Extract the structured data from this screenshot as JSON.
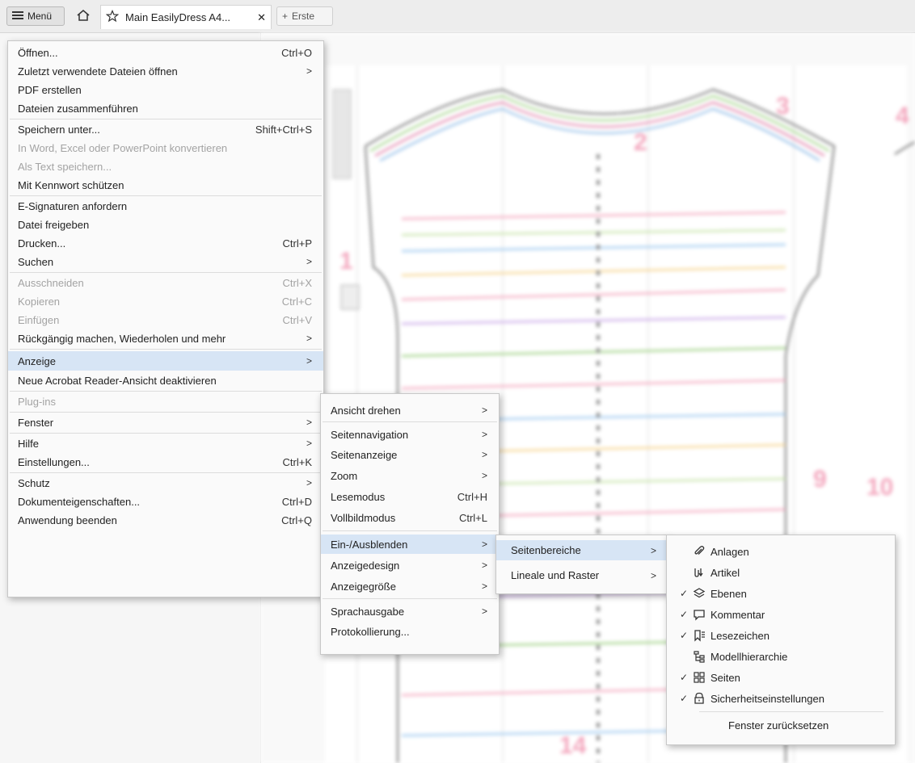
{
  "topbar": {
    "menu_label": "Menü",
    "tab_title": "Main EasilyDress A4...",
    "tab_close": "✕",
    "new_tab_label": "Erste"
  },
  "main_menu": {
    "items": [
      {
        "label": "Öffnen...",
        "shortcut": "Ctrl+O"
      },
      {
        "label": "Zuletzt verwendete Dateien öffnen",
        "arrow": ">"
      },
      {
        "label": "PDF erstellen"
      },
      {
        "label": "Dateien zusammenführen"
      },
      {
        "label": "Speichern unter...",
        "shortcut": "Shift+Ctrl+S"
      },
      {
        "label": "In Word, Excel oder PowerPoint konvertieren",
        "disabled": true
      },
      {
        "label": "Als Text speichern...",
        "disabled": true
      },
      {
        "label": "Mit Kennwort schützen"
      },
      {
        "label": "E-Signaturen anfordern"
      },
      {
        "label": "Datei freigeben"
      },
      {
        "label": "Drucken...",
        "shortcut": "Ctrl+P"
      },
      {
        "label": "Suchen",
        "arrow": ">"
      },
      {
        "label": "Ausschneiden",
        "shortcut": "Ctrl+X",
        "disabled": true
      },
      {
        "label": "Kopieren",
        "shortcut": "Ctrl+C",
        "disabled": true
      },
      {
        "label": "Einfügen",
        "shortcut": "Ctrl+V",
        "disabled": true
      },
      {
        "label": "Rückgängig machen, Wiederholen und mehr",
        "arrow": ">"
      },
      {
        "label": "Anzeige",
        "arrow": ">",
        "highlighted": true
      },
      {
        "label": "Neue Acrobat Reader-Ansicht deaktivieren"
      },
      {
        "label": "Plug-ins",
        "disabled": true
      },
      {
        "label": "Fenster",
        "arrow": ">"
      },
      {
        "label": "Hilfe",
        "arrow": ">"
      },
      {
        "label": "Einstellungen...",
        "shortcut": "Ctrl+K"
      },
      {
        "label": "Schutz",
        "arrow": ">"
      },
      {
        "label": "Dokumenteigenschaften...",
        "shortcut": "Ctrl+D"
      },
      {
        "label": "Anwendung beenden",
        "shortcut": "Ctrl+Q"
      }
    ]
  },
  "view_menu": {
    "items": [
      {
        "label": "Ansicht drehen",
        "arrow": ">"
      },
      {
        "label": "Seitennavigation",
        "arrow": ">"
      },
      {
        "label": "Seitenanzeige",
        "arrow": ">"
      },
      {
        "label": "Zoom",
        "arrow": ">"
      },
      {
        "label": "Lesemodus",
        "shortcut": "Ctrl+H"
      },
      {
        "label": "Vollbildmodus",
        "shortcut": "Ctrl+L"
      },
      {
        "label": "Ein-/Ausblenden",
        "arrow": ">",
        "highlighted": true
      },
      {
        "label": "Anzeigedesign",
        "arrow": ">"
      },
      {
        "label": "Anzeigegröße",
        "arrow": ">"
      },
      {
        "label": "Sprachausgabe",
        "arrow": ">"
      },
      {
        "label": "Protokollierung..."
      }
    ]
  },
  "showhide_menu": {
    "items": [
      {
        "label": "Seitenbereiche",
        "arrow": ">",
        "highlighted": true
      },
      {
        "label": "Lineale und Raster",
        "arrow": ">"
      }
    ]
  },
  "panes_menu": {
    "items": [
      {
        "label": "Anlagen",
        "icon": "paperclip-icon",
        "checked": false
      },
      {
        "label": "Artikel",
        "icon": "article-icon",
        "checked": false
      },
      {
        "label": "Ebenen",
        "icon": "layers-icon",
        "checked": true
      },
      {
        "label": "Kommentar",
        "icon": "comment-icon",
        "checked": true
      },
      {
        "label": "Lesezeichen",
        "icon": "bookmark-icon",
        "checked": true
      },
      {
        "label": "Modellhierarchie",
        "icon": "hierarchy-icon",
        "checked": false
      },
      {
        "label": "Seiten",
        "icon": "pages-icon",
        "checked": true
      },
      {
        "label": "Sicherheitseinstellungen",
        "icon": "lock-icon",
        "checked": true
      },
      {
        "label": "Fenster zurücksetzen"
      }
    ],
    "check_glyph": "✓"
  },
  "document": {
    "page_numbers": [
      "1",
      "2",
      "3",
      "4",
      "9",
      "10",
      "14"
    ]
  },
  "colors": {
    "highlight": "#d7e5f5",
    "menu_background": "#fafafa",
    "pattern_pink": "#f3a6bd",
    "disabled_text": "#a3a3a3"
  }
}
